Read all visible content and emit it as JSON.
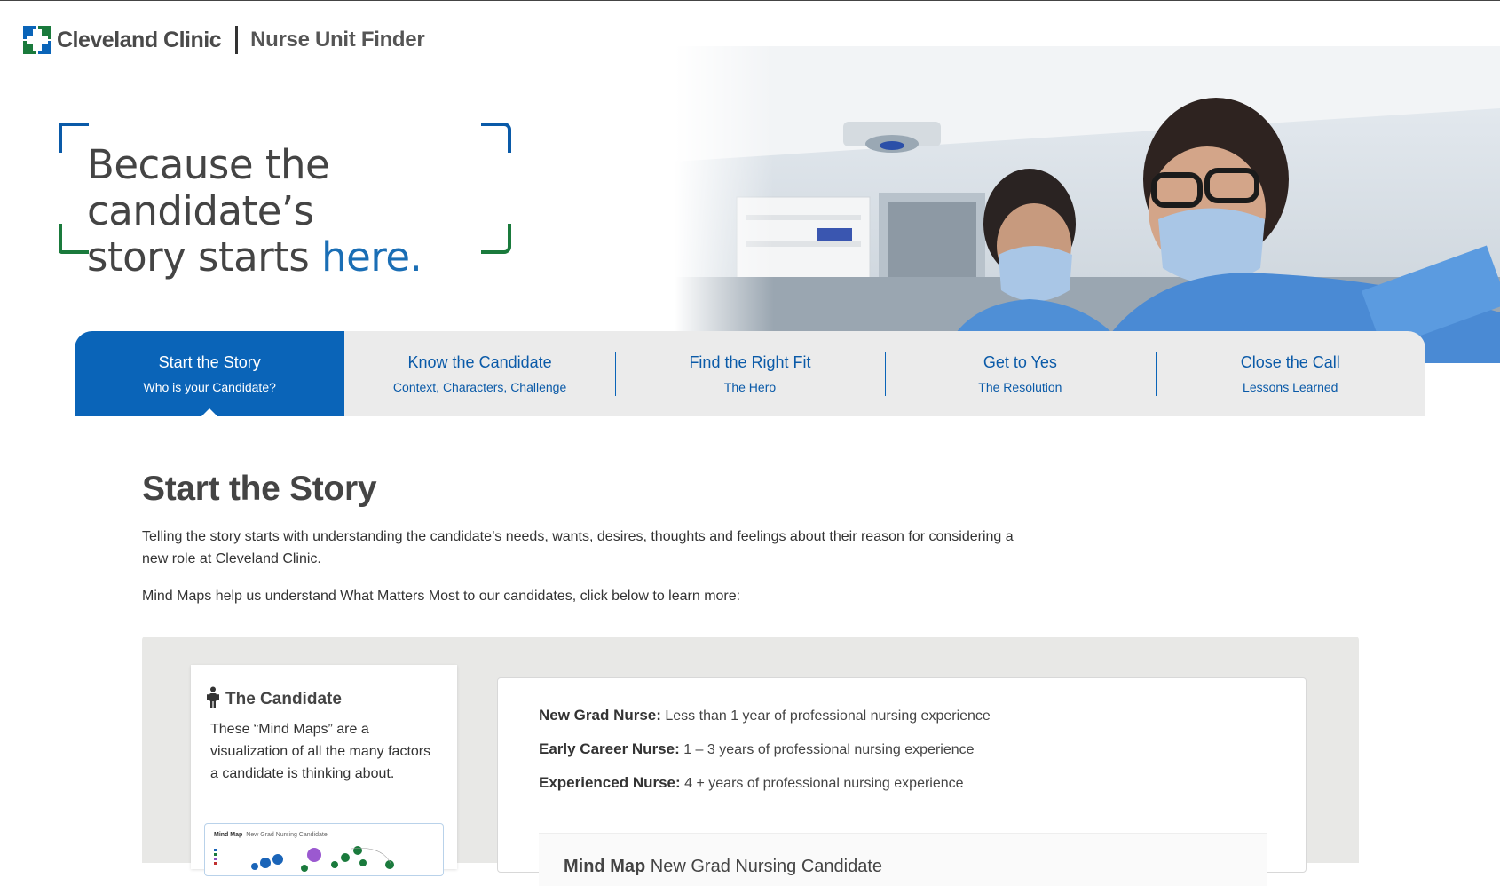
{
  "header": {
    "brand_name": "Cleveland Clinic",
    "app_name": "Nurse Unit Finder"
  },
  "hero": {
    "line1": "Because the candidate’s",
    "line2_prefix": "story starts ",
    "line2_accent": "here."
  },
  "tabs": [
    {
      "title": "Start the Story",
      "subtitle": "Who is your Candidate?",
      "active": true
    },
    {
      "title": "Know the Candidate",
      "subtitle": "Context, Characters, Challenge",
      "active": false
    },
    {
      "title": "Find the Right Fit",
      "subtitle": "The Hero",
      "active": false
    },
    {
      "title": "Get to Yes",
      "subtitle": "The Resolution",
      "active": false
    },
    {
      "title": "Close the Call",
      "subtitle": "Lessons Learned",
      "active": false
    }
  ],
  "main": {
    "title": "Start the Story",
    "intro": "Telling the story starts with understanding the candidate’s needs, wants, desires, thoughts and feelings about their reason for considering a new role at Cleveland Clinic.",
    "intro2": "Mind Maps help us understand What Matters Most to our candidates, click below to learn more:"
  },
  "card": {
    "icon": "person-icon",
    "title": "The Candidate",
    "body": "These “Mind Maps” are a visualization of all the many factors a candidate is thinking about.",
    "thumb_title": "Mind Map",
    "thumb_subtitle": "New Grad Nursing Candidate"
  },
  "definitions": [
    {
      "term": "New Grad Nurse:",
      "desc": " Less than 1 year of professional nursing experience"
    },
    {
      "term": "Early Career Nurse:",
      "desc": " 1 – 3 years of professional nursing experience"
    },
    {
      "term": "Experienced Nurse:",
      "desc": " 4 + years of professional nursing experience"
    }
  ],
  "mindmap": {
    "label": "Mind Map",
    "subtitle": "New Grad Nursing Candidate"
  },
  "colors": {
    "brand_blue": "#0a64b8",
    "accent_blue": "#1a6eb5",
    "brand_green": "#1a7a3c",
    "tab_bg": "#ebebeb",
    "panel_bg": "#e8e8e6"
  }
}
